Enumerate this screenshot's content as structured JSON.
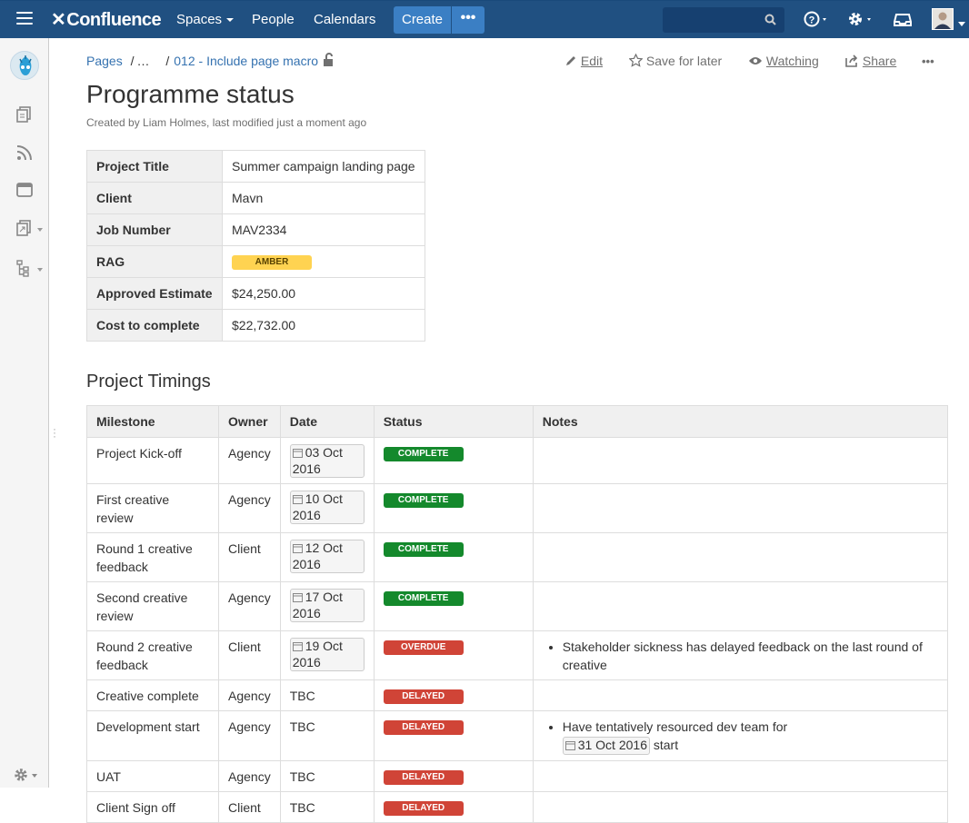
{
  "header": {
    "logo_text": "Confluence",
    "nav": {
      "spaces": "Spaces",
      "people": "People",
      "calendars": "Calendars"
    },
    "create_label": "Create",
    "more_label": "•••"
  },
  "breadcrumb": {
    "root": "Pages",
    "ellipsis": "…",
    "current": "012 - Include page macro"
  },
  "actions": {
    "edit": "Edit",
    "save": "Save for later",
    "watching": "Watching",
    "share": "Share",
    "more": "•••"
  },
  "page": {
    "title": "Programme status",
    "meta": "Created by Liam Holmes, last modified just a moment ago"
  },
  "summary": [
    {
      "label": "Project Title",
      "value": "Summer campaign landing page"
    },
    {
      "label": "Client",
      "value": "Mavn"
    },
    {
      "label": "Job Number",
      "value": "MAV2334"
    },
    {
      "label": "RAG",
      "value": "AMBER"
    },
    {
      "label": "Approved Estimate",
      "value": "$24,250.00"
    },
    {
      "label": "Cost to complete",
      "value": "$22,732.00"
    }
  ],
  "timings": {
    "heading": "Project Timings",
    "columns": [
      "Milestone",
      "Owner",
      "Date",
      "Status",
      "Notes"
    ],
    "rows": [
      {
        "milestone": "Project Kick-off",
        "owner": "Agency",
        "date": "03 Oct 2016",
        "status": "COMPLETE"
      },
      {
        "milestone": "First creative review",
        "owner": "Agency",
        "date": "10 Oct 2016",
        "status": "COMPLETE"
      },
      {
        "milestone": "Round 1 creative feedback",
        "owner": "Client",
        "date": "12 Oct 2016",
        "status": "COMPLETE"
      },
      {
        "milestone": "Second creative review",
        "owner": "Agency",
        "date": "17 Oct 2016",
        "status": "COMPLETE"
      },
      {
        "milestone": "Round 2 creative feedback",
        "owner": "Client",
        "date": "19 Oct 2016",
        "status": "OVERDUE",
        "note": "Stakeholder sickness has delayed feedback on the last round of creative"
      },
      {
        "milestone": "Creative complete",
        "owner": "Agency",
        "date": "TBC",
        "status": "DELAYED"
      },
      {
        "milestone": "Development start",
        "owner": "Agency",
        "date": "TBC",
        "status": "DELAYED",
        "note_pre": "Have tentatively resourced dev team for",
        "note_date": "31 Oct 2016",
        "note_post": "start"
      },
      {
        "milestone": "UAT",
        "owner": "Agency",
        "date": "TBC",
        "status": "DELAYED"
      },
      {
        "milestone": "Client Sign off",
        "owner": "Client",
        "date": "TBC",
        "status": "DELAYED"
      }
    ]
  },
  "colors": {
    "nav": "#205081",
    "complete": "#14892c",
    "delayed": "#d04437",
    "amber": "#ffd351",
    "link": "#3572b0"
  }
}
